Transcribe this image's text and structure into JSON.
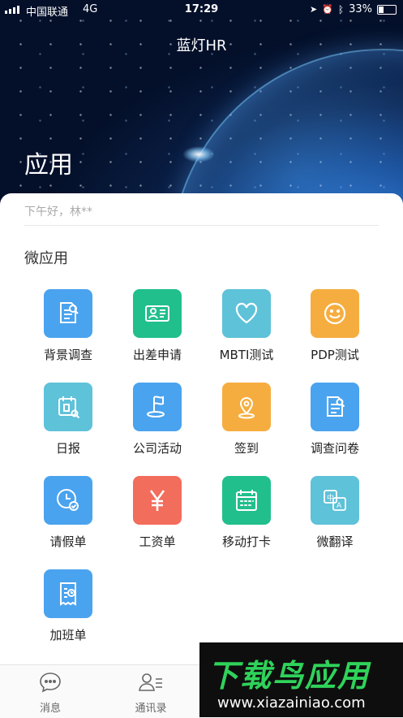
{
  "status_bar": {
    "carrier": "中国联通",
    "network": "4G",
    "time": "17:29",
    "battery": "33%"
  },
  "header": {
    "app_title": "蓝灯HR",
    "page_title": "应用"
  },
  "greeting": "下午好，林**",
  "section_title": "微应用",
  "apps": [
    {
      "label": "背景调查",
      "icon": "doc-search-icon",
      "color": "#4aa3ee"
    },
    {
      "label": "出差申请",
      "icon": "id-card-icon",
      "color": "#21bf8c"
    },
    {
      "label": "MBTI测试",
      "icon": "heart-icon",
      "color": "#5ec2d9"
    },
    {
      "label": "PDP测试",
      "icon": "smiley-icon",
      "color": "#f6ad3f"
    },
    {
      "label": "日报",
      "icon": "calendar-search-icon",
      "color": "#5ec2d9"
    },
    {
      "label": "公司活动",
      "icon": "flag-icon",
      "color": "#4aa3ee"
    },
    {
      "label": "签到",
      "icon": "location-pin-icon",
      "color": "#f6ad3f"
    },
    {
      "label": "调查问卷",
      "icon": "survey-icon",
      "color": "#4aa3ee"
    },
    {
      "label": "请假单",
      "icon": "clock-check-icon",
      "color": "#4aa3ee"
    },
    {
      "label": "工资单",
      "icon": "yen-icon",
      "color": "#f26d5b"
    },
    {
      "label": "移动打卡",
      "icon": "calendar-grid-icon",
      "color": "#21bf8c"
    },
    {
      "label": "微翻译",
      "icon": "translate-icon",
      "color": "#5ec2d9"
    },
    {
      "label": "加班单",
      "icon": "overtime-doc-icon",
      "color": "#4aa3ee"
    }
  ],
  "tabs": [
    {
      "label": "消息",
      "icon": "message-icon"
    },
    {
      "label": "通讯录",
      "icon": "contacts-icon"
    }
  ],
  "watermark": {
    "title": "下载鸟应用",
    "url": "www.xiazainiao.com"
  }
}
